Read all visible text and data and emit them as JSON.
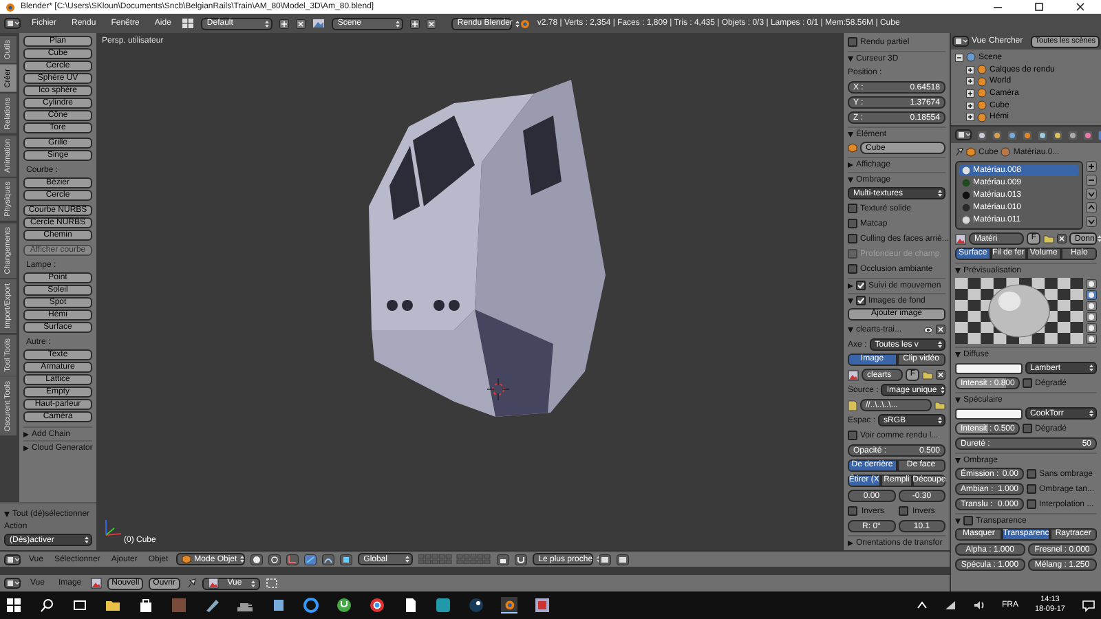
{
  "window": {
    "title": "Blender* [C:\\Users\\SKloun\\Documents\\Sncb\\BelgianRails\\Train\\AM_80\\Model_3D\\Am_80.blend]"
  },
  "menu_bar": {
    "menus": [
      "Fichier",
      "Rendu",
      "Fenêtre",
      "Aide"
    ],
    "layout": "Default",
    "scene": "Scene",
    "engine": "Rendu Blender",
    "stats": "v2.78 | Verts : 2,354 | Faces : 1,809 | Tris : 4,435 | Objets : 0/3 | Lampes : 0/1 | Mem:58.56M | Cube"
  },
  "tool_tabs": [
    {
      "label": "Outils",
      "selected": false
    },
    {
      "label": "Créer",
      "selected": true
    },
    {
      "label": "Relations",
      "selected": false
    },
    {
      "label": "Animation",
      "selected": false
    },
    {
      "label": "Physiques",
      "selected": false
    },
    {
      "label": "Changements",
      "selected": false
    },
    {
      "label": "Import/Export",
      "selected": false
    },
    {
      "label": "Tool Tools",
      "selected": false
    },
    {
      "label": "Oscurent Tools",
      "selected": false
    }
  ],
  "tool_shelf": {
    "groups": [
      {
        "blocks": [
          [
            {
              "label": "Plan",
              "disabled": false
            },
            {
              "label": "Cube",
              "disabled": false
            },
            {
              "label": "Cercle",
              "disabled": false
            },
            {
              "label": "Sphère UV",
              "disabled": false
            },
            {
              "label": "Ico sphère",
              "disabled": false
            },
            {
              "label": "Cylindre",
              "disabled": false
            },
            {
              "label": "Cône",
              "disabled": false
            },
            {
              "label": "Tore",
              "disabled": false
            }
          ],
          [
            {
              "label": "Grille",
              "disabled": false
            },
            {
              "label": "Singe",
              "disabled": false
            }
          ]
        ]
      },
      {
        "title": "Courbe :",
        "blocks": [
          [
            {
              "label": "Bézier",
              "disabled": false
            },
            {
              "label": "Cercle",
              "disabled": false
            }
          ],
          [
            {
              "label": "Courbe NURBS",
              "disabled": false
            },
            {
              "label": "Cercle NURBS",
              "disabled": false
            },
            {
              "label": "Chemin",
              "disabled": false
            }
          ],
          [
            {
              "label": "Afficher courbe",
              "disabled": true
            }
          ]
        ]
      },
      {
        "title": "Lampe :",
        "blocks": [
          [
            {
              "label": "Point",
              "disabled": false
            },
            {
              "label": "Soleil",
              "disabled": false
            },
            {
              "label": "Spot",
              "disabled": false
            },
            {
              "label": "Hémi",
              "disabled": false
            },
            {
              "label": "Surface",
              "disabled": false
            }
          ]
        ]
      },
      {
        "title": "Autre :",
        "blocks": [
          [
            {
              "label": "Texte",
              "disabled": false
            },
            {
              "label": "Armature",
              "disabled": false
            },
            {
              "label": "Lattice",
              "disabled": false
            },
            {
              "label": "Empty",
              "disabled": false
            },
            {
              "label": "Haut-parleur",
              "disabled": false
            },
            {
              "label": "Caméra",
              "disabled": false
            }
          ]
        ]
      }
    ],
    "panels": [
      {
        "label": "Add Chain",
        "expanded": false
      },
      {
        "label": "Cloud Generator",
        "expanded": false
      }
    ],
    "operator": {
      "title": "Tout (dé)sélectionner",
      "expanded": true,
      "label": "Action",
      "value": "(Dés)activer"
    }
  },
  "viewport": {
    "view_name": "Persp. utilisateur",
    "object_info": "(0) Cube"
  },
  "n_panel": {
    "rows": [
      {
        "kind": "check",
        "label": "Rendu partiel",
        "checked": false,
        "disabled": false
      },
      {
        "kind": "section",
        "label": "Curseur 3D",
        "expanded": true
      },
      {
        "kind": "label",
        "text": "Position :"
      },
      {
        "kind": "number",
        "label": "X :",
        "value": "0.64518"
      },
      {
        "kind": "number",
        "label": "Y :",
        "value": "1.37674"
      },
      {
        "kind": "number",
        "label": "Z :",
        "value": "0.18554"
      },
      {
        "kind": "section",
        "label": "Élément",
        "expanded": true
      },
      {
        "kind": "name",
        "value": "Cube"
      },
      {
        "kind": "section",
        "label": "Affichage",
        "expanded": false
      },
      {
        "kind": "section",
        "label": "Ombrage",
        "expanded": true
      },
      {
        "kind": "dropdown",
        "value": "Multi-textures"
      },
      {
        "kind": "check",
        "label": "Texturé solide",
        "checked": false,
        "disabled": false
      },
      {
        "kind": "check",
        "label": "Matcap",
        "checked": false,
        "disabled": false
      },
      {
        "kind": "check",
        "label": "Culling des faces arriè...",
        "checked": false,
        "disabled": false
      },
      {
        "kind": "check",
        "label": "Profondeur de champ",
        "checked": false,
        "disabled": true
      },
      {
        "kind": "check",
        "label": "Occlusion ambiante",
        "checked": false,
        "disabled": false
      },
      {
        "kind": "check_section",
        "label": "Suivi de mouvemen",
        "expanded": false,
        "checked": true
      },
      {
        "kind": "check_section",
        "label": "Images de fond",
        "expanded": true,
        "checked": true
      },
      {
        "kind": "button",
        "label": "Ajouter image"
      },
      {
        "kind": "subpanel",
        "label": "clearts-trai...",
        "expanded": true
      },
      {
        "kind": "prop_dropdown",
        "label": "Axe :",
        "value": "Toutes les v"
      },
      {
        "kind": "tabs",
        "items": [
          {
            "label": "Image",
            "selected": true
          },
          {
            "label": "Clip vidéo",
            "selected": false
          }
        ]
      },
      {
        "kind": "datablock",
        "value": "clearts",
        "extra": "F"
      },
      {
        "kind": "prop_dropdown",
        "label": "Source :",
        "value": "Image unique"
      },
      {
        "kind": "filepath",
        "value": "//..\\..\\..\\..."
      },
      {
        "kind": "prop_dropdown",
        "label": "Espac :",
        "value": "sRGB"
      },
      {
        "kind": "check",
        "label": "Voir comme rendu l...",
        "checked": false,
        "disabled": false
      },
      {
        "kind": "number",
        "label": "Opacité :",
        "value": "0.500"
      },
      {
        "kind": "tabs",
        "items": [
          {
            "label": "De derrière",
            "selected": true
          },
          {
            "label": "De face",
            "selected": false
          }
        ]
      },
      {
        "kind": "tabs",
        "items": [
          {
            "label": "Étirer (X",
            "selected": true
          },
          {
            "label": "Rempli",
            "selected": false
          },
          {
            "label": "Découpe",
            "selected": false
          }
        ]
      },
      {
        "kind": "numbers",
        "items": [
          "0.00",
          "-0.30"
        ]
      },
      {
        "kind": "checks",
        "items": [
          {
            "label": "Invers",
            "checked": false
          },
          {
            "label": "Invers",
            "checked": false
          }
        ]
      },
      {
        "kind": "numbers",
        "items": [
          "R: 0°",
          "10.1"
        ]
      },
      {
        "kind": "section",
        "label": "Orientations de transfor",
        "expanded": false
      }
    ]
  },
  "outliner": {
    "menus": [
      "Vue",
      "Chercher"
    ],
    "filter": "Toutes les scènes",
    "tree": [
      {
        "label": "Scene",
        "expanded": true,
        "children": [
          {
            "label": "Calques de rendu",
            "expanded": false
          },
          {
            "label": "World",
            "expanded": false
          },
          {
            "label": "Caméra",
            "expanded": false
          },
          {
            "label": "Cube",
            "expanded": false
          },
          {
            "label": "Hémi",
            "expanded": false
          }
        ]
      }
    ]
  },
  "properties": {
    "rows": [
      {
        "kind": "breadcrumb",
        "items": [
          "Cube",
          "Matériau.0..."
        ]
      },
      {
        "kind": "list",
        "items": [
          {
            "label": "Matériau.008",
            "selected": true,
            "color": "#e0e0e0"
          },
          {
            "label": "Matériau.009",
            "selected": false,
            "color": "#1f4a1f"
          },
          {
            "label": "Matériau.013",
            "selected": false,
            "color": "#111111"
          },
          {
            "label": "Matériau.010",
            "selected": false,
            "color": "#2a2a2a"
          },
          {
            "label": "Matériau.011",
            "selected": false,
            "color": "#d8d8d8"
          }
        ]
      },
      {
        "kind": "datablock",
        "value": "Matéri",
        "extra": "F",
        "right": "Donn"
      },
      {
        "kind": "tabs",
        "items": [
          {
            "label": "Surface",
            "selected": true
          },
          {
            "label": "Fil de fer",
            "selected": false
          },
          {
            "label": "Volume",
            "selected": false
          },
          {
            "label": "Halo",
            "selected": false
          }
        ]
      },
      {
        "kind": "section",
        "label": "Prévisualisation",
        "expanded": true
      },
      {
        "kind": "preview"
      },
      {
        "kind": "section",
        "label": "Diffuse",
        "expanded": true
      },
      {
        "kind": "shader",
        "value": "Lambert"
      },
      {
        "kind": "intensity",
        "label": "Intensit :",
        "value": "0.800",
        "level": 0.8,
        "check": "Dégradé",
        "checked": false
      },
      {
        "kind": "section",
        "label": "Spéculaire",
        "expanded": true
      },
      {
        "kind": "shader",
        "value": "CookTorr"
      },
      {
        "kind": "intensity",
        "label": "Intensit :",
        "value": "0.500",
        "level": 0.5,
        "check": "Dégradé",
        "checked": false
      },
      {
        "kind": "number",
        "label": "Dureté :",
        "value": "50"
      },
      {
        "kind": "section",
        "label": "Ombrage",
        "expanded": true
      },
      {
        "kind": "num_check",
        "label": "Émission :",
        "value": "0.00",
        "check": "Sans ombrage",
        "checked": false
      },
      {
        "kind": "num_check",
        "label": "Ambian :",
        "value": "1.000",
        "check": "Ombrage tan...",
        "checked": false
      },
      {
        "kind": "num_check",
        "label": "Translu :",
        "value": "0.000",
        "check": "Interpolation ...",
        "checked": false
      },
      {
        "kind": "check_section",
        "label": "Transparence",
        "expanded": true,
        "checked": false
      },
      {
        "kind": "tabs",
        "items": [
          {
            "label": "Masquer",
            "selected": false
          },
          {
            "label": "Transparenc",
            "selected": true
          },
          {
            "label": "Raytracer",
            "selected": false
          }
        ]
      },
      {
        "kind": "numbers",
        "items": [
          "Alpha : 1.000",
          "Fresnel : 0.000"
        ]
      },
      {
        "kind": "numbers",
        "items": [
          "Spécula : 1.000",
          "Mélang : 1.250"
        ]
      }
    ]
  },
  "header_3d": {
    "menus": [
      "Vue",
      "Sélectionner",
      "Ajouter",
      "Objet"
    ],
    "mode": "Mode Objet",
    "orientation": "Global",
    "snap": "Le plus proche"
  },
  "header_image": {
    "menus": [
      "Vue",
      "Image"
    ],
    "new": "Nouvell",
    "open": "Ouvrir",
    "view": "Vue"
  },
  "taskbar": {
    "language": "FRA",
    "time": "14:13",
    "date": "18-09-17"
  }
}
